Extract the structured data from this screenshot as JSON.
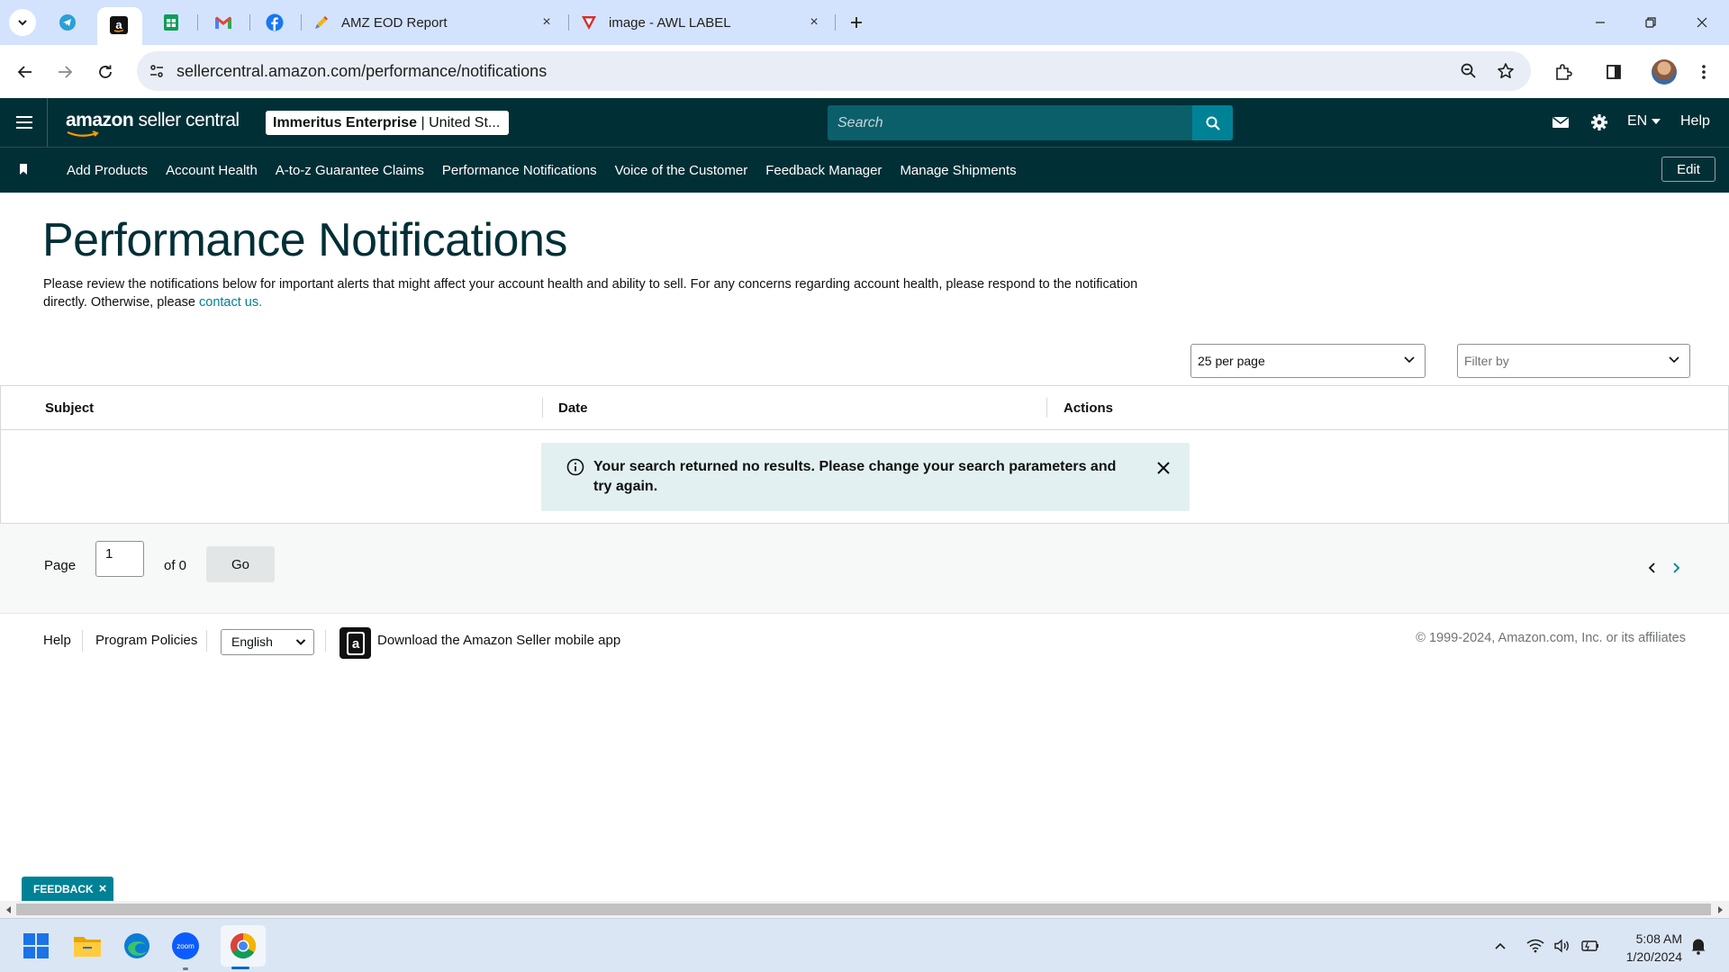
{
  "browser": {
    "tabs": [
      {
        "title": "AMZ EOD Report",
        "close": "×"
      },
      {
        "title": "image - AWL LABEL",
        "close": "×"
      }
    ],
    "pinned_tabs": [
      "telegram-icon",
      "amazon-icon",
      "google-sheets-icon",
      "gmail-icon",
      "facebook-icon"
    ],
    "url": "sellercentral.amazon.com/performance/notifications"
  },
  "header": {
    "logo_part1": "amazon",
    "logo_part2": " seller central",
    "account_name": "Immeritus Enterprise",
    "account_region": " | United St...",
    "search_placeholder": "Search",
    "language": "EN",
    "help": "Help"
  },
  "nav": {
    "links": [
      "Add Products",
      "Account Health",
      "A-to-z Guarantee Claims",
      "Performance Notifications",
      "Voice of the Customer",
      "Feedback Manager",
      "Manage Shipments"
    ],
    "edit": "Edit"
  },
  "page": {
    "title": "Performance Notifications",
    "intro_text": "Please review the notifications below for important alerts that might affect your account health and ability to sell. For any concerns regarding account health, please respond to the notification directly. Otherwise, please ",
    "intro_link": "contact us.",
    "per_page": "25 per page",
    "filter_placeholder": "Filter by"
  },
  "table": {
    "columns": [
      "Subject",
      "Date",
      "Actions"
    ],
    "empty_message": "Your search returned no results. Please change your search parameters and try again."
  },
  "pagination": {
    "page_label": "Page",
    "current_page": "1",
    "of_label": "of 0",
    "go": "Go"
  },
  "footer": {
    "help": "Help",
    "program_policies": "Program Policies",
    "language": "English",
    "app_text": "Download the Amazon Seller mobile app",
    "copyright": "© 1999-2024, Amazon.com, Inc. or its affiliates"
  },
  "feedback": {
    "label": "FEEDBACK",
    "close": "×"
  },
  "taskbar": {
    "apps": [
      "windows-start-icon",
      "file-explorer-icon",
      "edge-icon",
      "zoom-icon",
      "chrome-icon"
    ],
    "zoom_label": "zoom",
    "time": "5:08 AM",
    "date": "1/20/2024"
  },
  "colors": {
    "header_bg": "#002f36",
    "accent": "#008296",
    "alert_bg": "#e3f0f1"
  }
}
